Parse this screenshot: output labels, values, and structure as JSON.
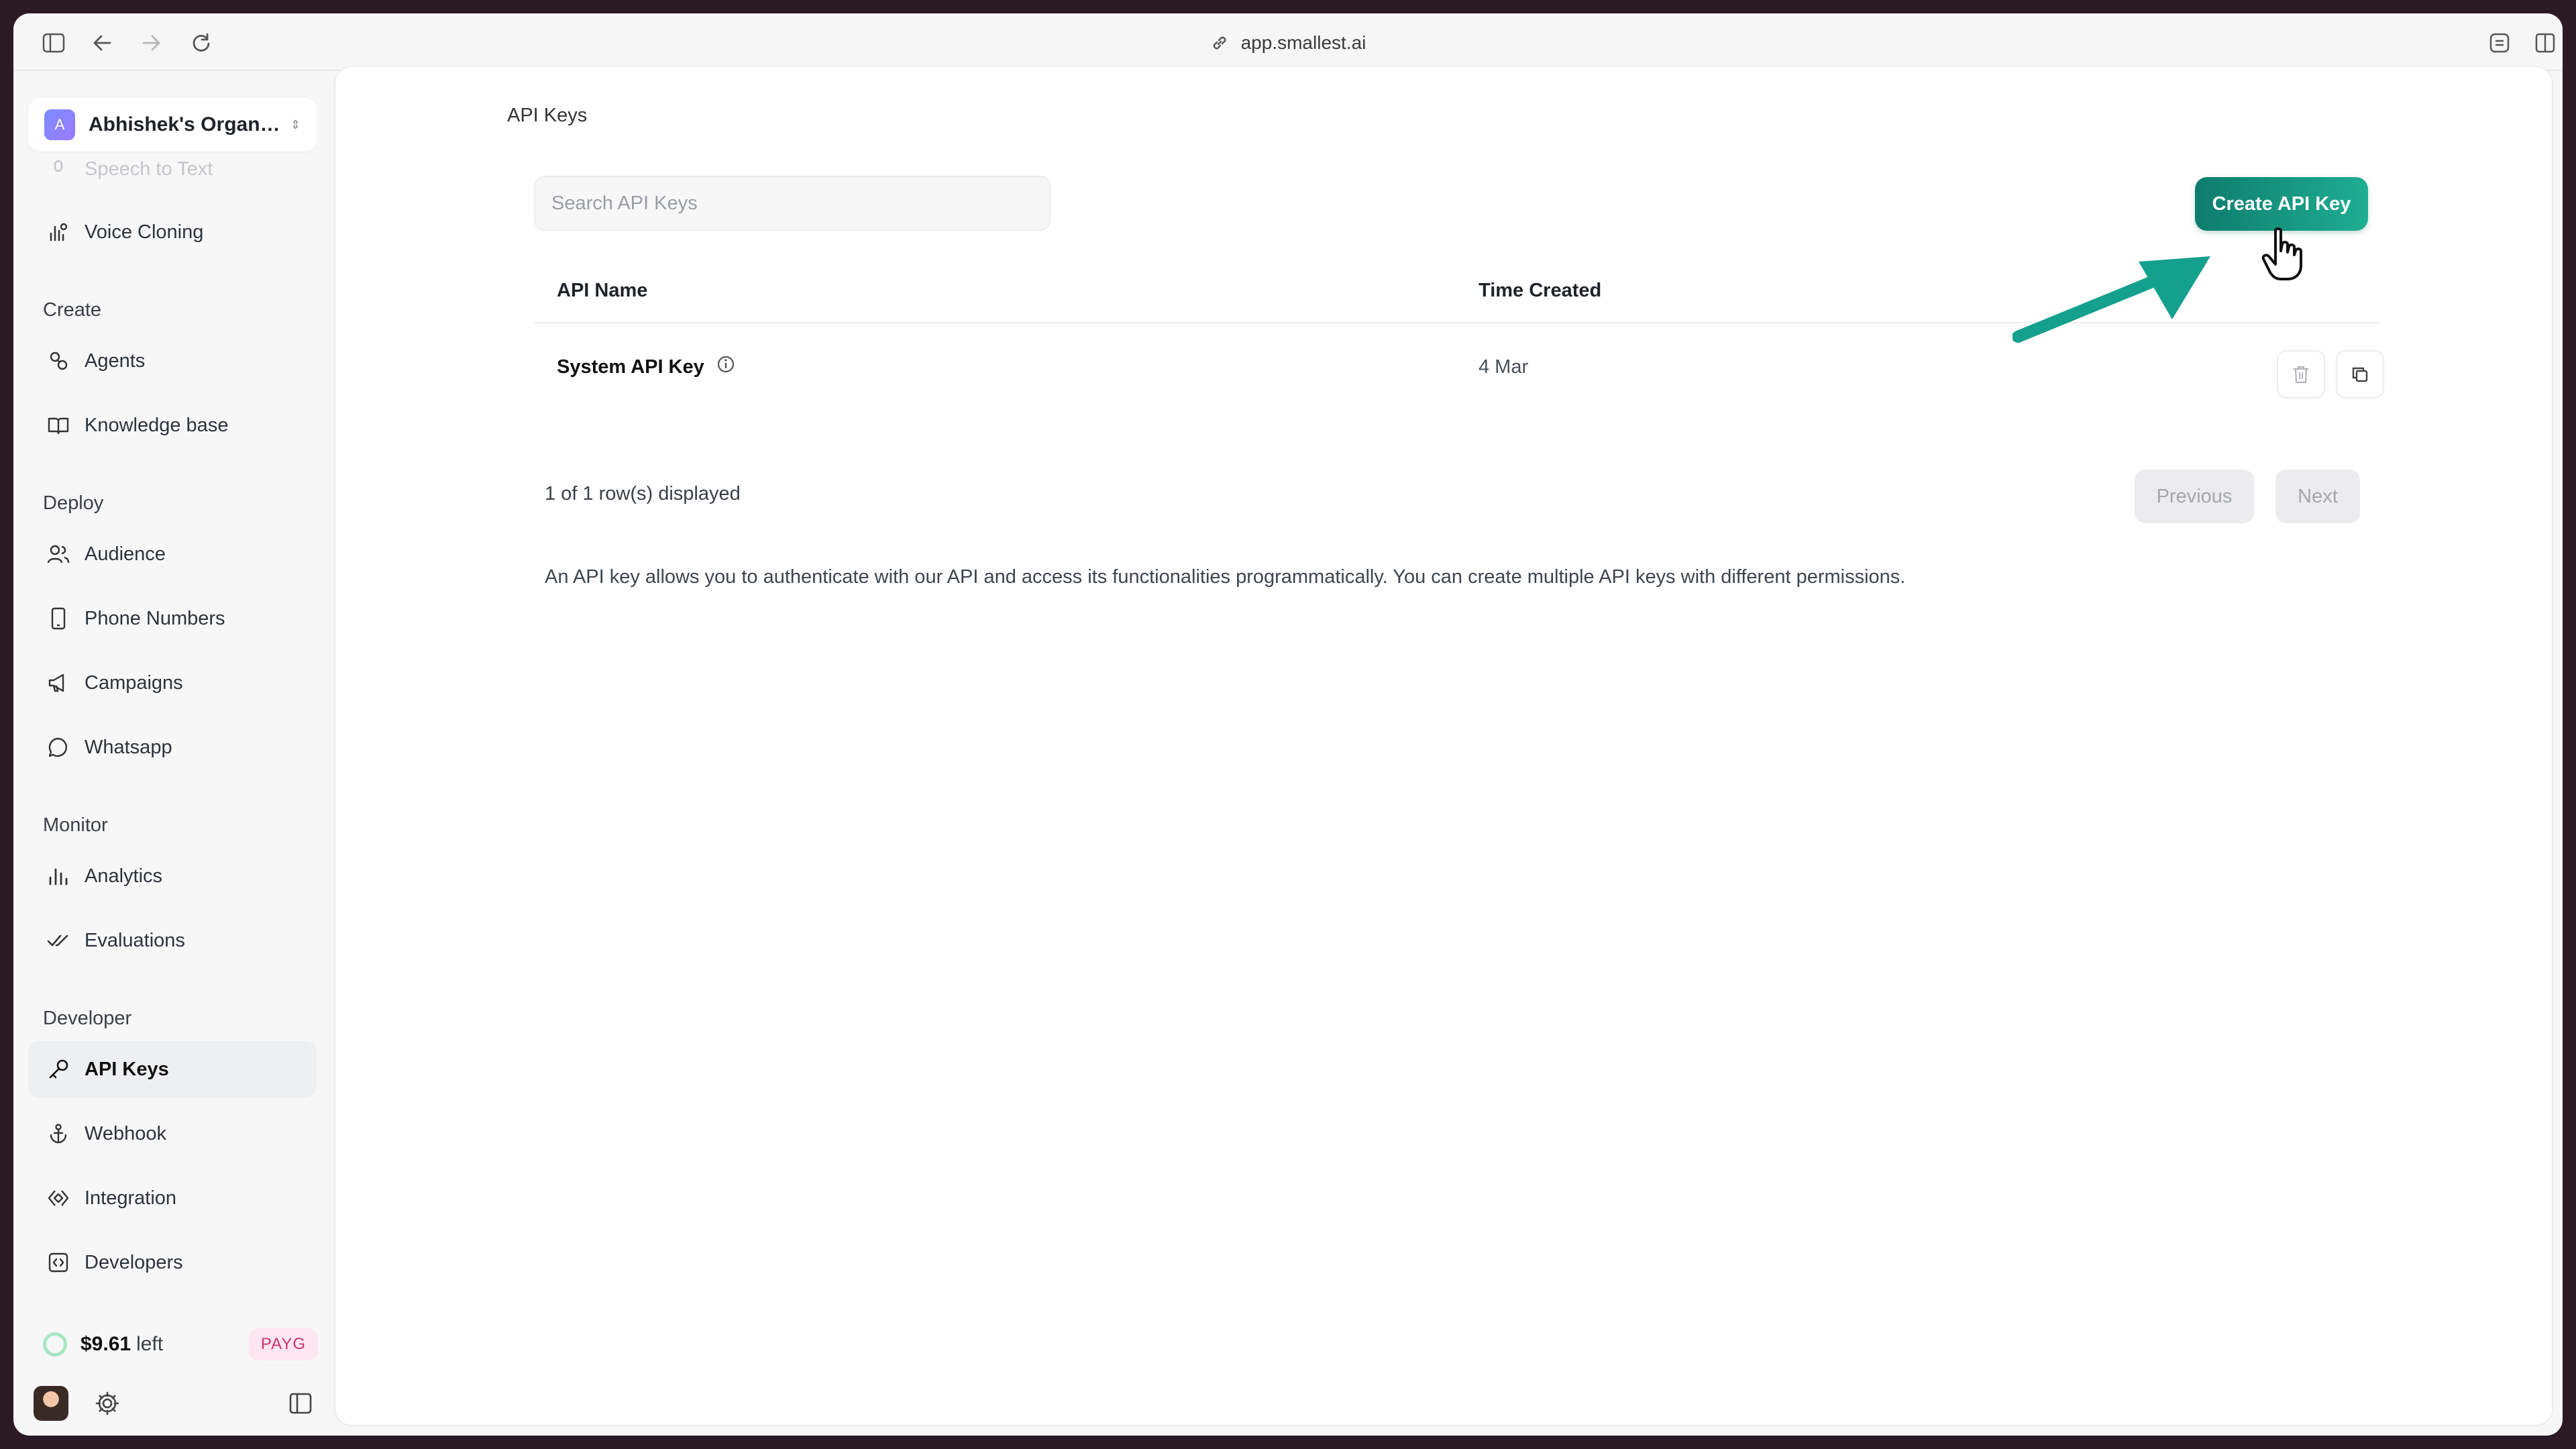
{
  "browser": {
    "url": "app.smallest.ai"
  },
  "org": {
    "initial": "A",
    "name": "Abhishek's Organis..."
  },
  "sidebar": {
    "partial_item": "Speech to Text",
    "voice_cloning": "Voice Cloning",
    "sections": {
      "create": "Create",
      "deploy": "Deploy",
      "monitor": "Monitor",
      "developer": "Developer"
    },
    "items": {
      "agents": "Agents",
      "knowledge_base": "Knowledge base",
      "audience": "Audience",
      "phone_numbers": "Phone Numbers",
      "campaigns": "Campaigns",
      "whatsapp": "Whatsapp",
      "analytics": "Analytics",
      "evaluations": "Evaluations",
      "api_keys": "API Keys",
      "webhook": "Webhook",
      "integration": "Integration",
      "developers": "Developers"
    },
    "active_item": "API Keys",
    "credit": {
      "amount": "$9.61",
      "suffix": "left",
      "plan_badge": "PAYG"
    }
  },
  "main": {
    "breadcrumb": "API Keys",
    "search_placeholder": "Search API Keys",
    "create_button": "Create API Key",
    "table": {
      "headers": [
        "API Name",
        "Time Created"
      ],
      "rows": [
        {
          "name": "System API Key",
          "time_created": "4 Mar"
        }
      ]
    },
    "rows_displayed": "1 of 1 row(s) displayed",
    "pagination": {
      "previous": "Previous",
      "next": "Next"
    },
    "description": "An API key allows you to authenticate with our API and access its functionalities programmatically. You can create multiple API keys with different permissions."
  },
  "colors": {
    "accent": "#15907e",
    "annotation_arrow": "#13a08c",
    "payg_text": "#d0336d"
  }
}
